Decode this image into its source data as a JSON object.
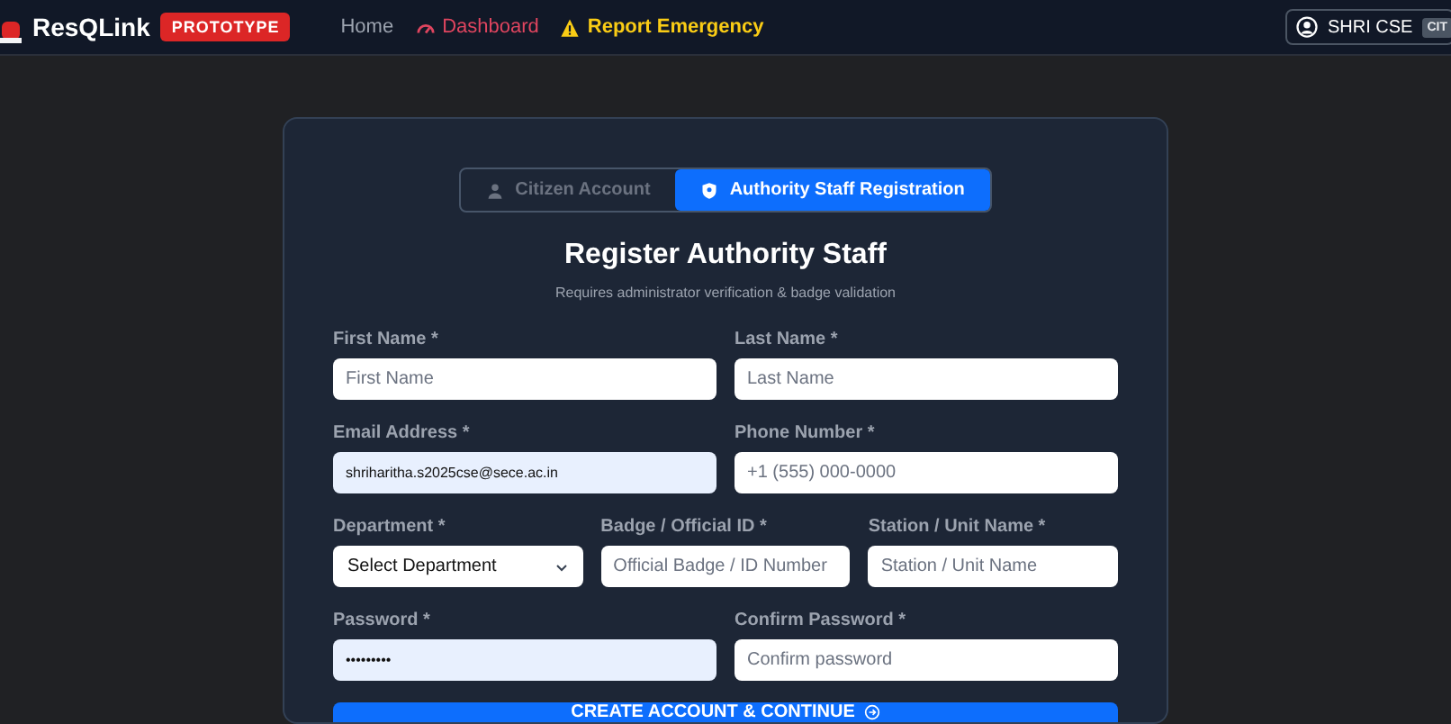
{
  "nav": {
    "brand": "ResQLink",
    "badge": "PROTOTYPE",
    "links": [
      {
        "label": "Home",
        "kind": "plain"
      },
      {
        "label": "Dashboard",
        "kind": "dashboard"
      },
      {
        "label": "Report Emergency",
        "kind": "emergency"
      }
    ],
    "user": {
      "name": "SHRI CSE",
      "role": "CIT"
    }
  },
  "tabs": [
    {
      "label": "Citizen Account",
      "kind": "person",
      "selected": false
    },
    {
      "label": "Authority Staff Registration",
      "kind": "shield",
      "selected": true
    }
  ],
  "title": "Register Authority Staff",
  "subtitle": "Requires administrator verification & badge validation",
  "rows": [
    [
      {
        "label": "First Name *",
        "kind": "text",
        "placeholder": "First Name"
      },
      {
        "label": "Last Name *",
        "kind": "text",
        "placeholder": "Last Name"
      }
    ],
    [
      {
        "label": "Email Address *",
        "kind": "text",
        "value": "shriharitha.s2025cse@sece.ac.in",
        "autofilled": true
      },
      {
        "label": "Phone Number *",
        "kind": "text",
        "placeholder": "+1 (555) 000-0000"
      }
    ],
    [
      {
        "label": "Department *",
        "kind": "select",
        "value": "Select Department"
      },
      {
        "label": "Badge / Official ID *",
        "kind": "text",
        "placeholder": "Official Badge / ID Number"
      },
      {
        "label": "Station / Unit Name *",
        "kind": "text",
        "placeholder": "Station / Unit Name"
      }
    ],
    [
      {
        "label": "Password *",
        "kind": "text",
        "value": "•••••••••",
        "autofilled": true
      },
      {
        "label": "Confirm Password *",
        "kind": "text",
        "placeholder": "Confirm password"
      }
    ]
  ],
  "submit": "CREATE ACCOUNT & CONTINUE"
}
